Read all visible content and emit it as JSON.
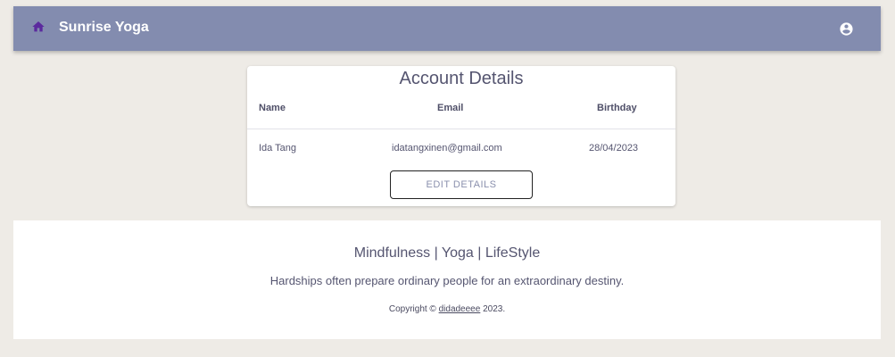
{
  "header": {
    "brand": "Sunrise Yoga",
    "home_icon": "home-icon",
    "account_icon": "account-circle-icon",
    "colors": {
      "bar": "#838caf",
      "home_icon": "#5b2a9e"
    }
  },
  "account": {
    "title": "Account Details",
    "columns": [
      "Name",
      "Email",
      "Birthday"
    ],
    "row": {
      "name": "Ida Tang",
      "email": "idatangxinen@gmail.com",
      "birthday": "28/04/2023"
    },
    "edit_label": "EDIT DETAILS"
  },
  "footer": {
    "tagline": "Mindfulness | Yoga | LifeStyle",
    "quote": "Hardships often prepare ordinary people for an extraordinary destiny.",
    "copyright_prefix": "Copyright ©",
    "copyright_link": "didadeeee",
    "copyright_suffix": "2023."
  }
}
